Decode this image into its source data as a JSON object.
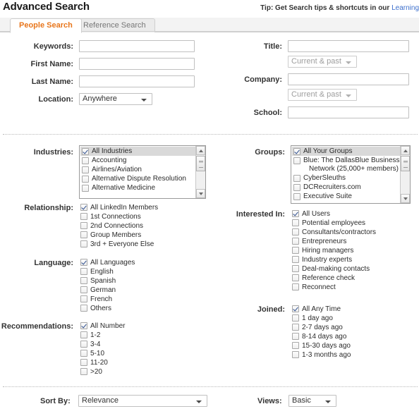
{
  "header": {
    "title": "Advanced Search",
    "tip_prefix": "Tip: Get Search tips & shortcuts in our ",
    "tip_link": "Learning",
    "accent_color": "#e8761c",
    "link_color": "#3b6ecc"
  },
  "tabs": [
    {
      "label": "People Search",
      "active": true
    },
    {
      "label": "Reference Search",
      "active": false
    }
  ],
  "form": {
    "left": [
      {
        "label": "Keywords:",
        "type": "text",
        "value": "",
        "placeholder": ""
      },
      {
        "label": "First Name:",
        "type": "text",
        "value": "",
        "placeholder": ""
      },
      {
        "label": "Last Name:",
        "type": "text",
        "value": "",
        "placeholder": ""
      },
      {
        "label": "Location:",
        "type": "select",
        "value": "Anywhere"
      }
    ],
    "right": [
      {
        "label": "Title:",
        "type": "text",
        "value": ""
      },
      {
        "label": "",
        "type": "select",
        "value": "Current & past",
        "disabled": true
      },
      {
        "label": "Company:",
        "type": "text",
        "value": ""
      },
      {
        "label": "",
        "type": "select",
        "value": "Current & past",
        "disabled": true
      },
      {
        "label": "School:",
        "type": "text",
        "value": ""
      }
    ]
  },
  "industries": {
    "label": "Industries:",
    "items": [
      {
        "text": "All Industries",
        "checked": true,
        "selected": true
      },
      {
        "text": "Accounting",
        "checked": false
      },
      {
        "text": "Airlines/Aviation",
        "checked": false
      },
      {
        "text": "Alternative Dispute Resolution",
        "checked": false
      },
      {
        "text": "Alternative Medicine",
        "checked": false
      }
    ]
  },
  "groups": {
    "label": "Groups:",
    "items": [
      {
        "text": "All Your Groups",
        "checked": true,
        "selected": true
      },
      {
        "text": "Blue: The DallasBlue Business",
        "text2": "Network (25,000+ members)",
        "checked": false
      },
      {
        "text": "CyberSleuths",
        "checked": false
      },
      {
        "text": "DCRecruiters.com",
        "checked": false
      },
      {
        "text": "Executive Suite",
        "checked": false
      }
    ]
  },
  "relationship": {
    "label": "Relationship:",
    "items": [
      {
        "text": "All LinkedIn Members",
        "checked": true
      },
      {
        "text": "1st Connections",
        "checked": false
      },
      {
        "text": "2nd Connections",
        "checked": false
      },
      {
        "text": "Group Members",
        "checked": false
      },
      {
        "text": "3rd + Everyone Else",
        "checked": false
      }
    ]
  },
  "language": {
    "label": "Language:",
    "items": [
      {
        "text": "All Languages",
        "checked": true
      },
      {
        "text": "English",
        "checked": false
      },
      {
        "text": "Spanish",
        "checked": false
      },
      {
        "text": "German",
        "checked": false
      },
      {
        "text": "French",
        "checked": false
      },
      {
        "text": "Others",
        "checked": false
      }
    ]
  },
  "recommendations": {
    "label": "Recommendations:",
    "items": [
      {
        "text": "All Number",
        "checked": true
      },
      {
        "text": "1-2",
        "checked": false
      },
      {
        "text": "3-4",
        "checked": false
      },
      {
        "text": "5-10",
        "checked": false
      },
      {
        "text": "11-20",
        "checked": false
      },
      {
        "text": ">20",
        "checked": false
      }
    ]
  },
  "interested_in": {
    "label": "Interested In:",
    "items": [
      {
        "text": "All Users",
        "checked": true
      },
      {
        "text": "Potential employees",
        "checked": false
      },
      {
        "text": "Consultants/contractors",
        "checked": false
      },
      {
        "text": "Entrepreneurs",
        "checked": false
      },
      {
        "text": "Hiring managers",
        "checked": false
      },
      {
        "text": "Industry experts",
        "checked": false
      },
      {
        "text": "Deal-making contacts",
        "checked": false
      },
      {
        "text": "Reference check",
        "checked": false
      },
      {
        "text": "Reconnect",
        "checked": false
      }
    ]
  },
  "joined": {
    "label": "Joined:",
    "items": [
      {
        "text": "All Any Time",
        "checked": true
      },
      {
        "text": "1 day ago",
        "checked": false
      },
      {
        "text": "2-7 days ago",
        "checked": false
      },
      {
        "text": "8-14 days ago",
        "checked": false
      },
      {
        "text": "15-30 days ago",
        "checked": false
      },
      {
        "text": "1-3 months ago",
        "checked": false
      }
    ]
  },
  "bottom": {
    "sort_label": "Sort By:",
    "sort_value": "Relevance",
    "views_label": "Views:",
    "views_value": "Basic"
  }
}
